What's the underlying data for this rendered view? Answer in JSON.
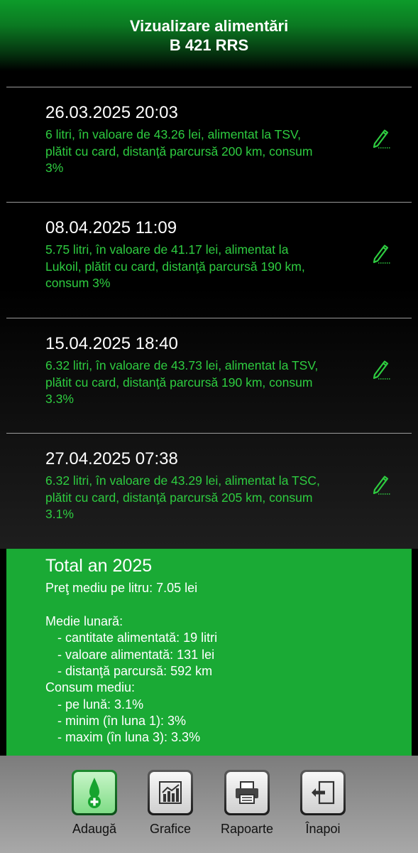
{
  "header": {
    "title": "Vizualizare alimentări",
    "subtitle": "B 421 RRS"
  },
  "entries": [
    {
      "date": "26.03.2025 20:03",
      "lines": [
        "6 litri, în valoare de 43.26 lei, alimentat la TSV,",
        "plătit cu card, distanţă parcursă 200 km, consum",
        "3%"
      ]
    },
    {
      "date": "08.04.2025 11:09",
      "lines": [
        "5.75 litri, în valoare de 41.17 lei, alimentat la",
        "Lukoil, plătit cu card, distanţă parcursă 190 km,",
        "consum 3%"
      ]
    },
    {
      "date": "15.04.2025 18:40",
      "lines": [
        "6.32 litri, în valoare de 43.73 lei, alimentat la TSV,",
        "plătit cu card, distanţă parcursă 190 km, consum",
        "3.3%"
      ]
    },
    {
      "date": "27.04.2025 07:38",
      "lines": [
        "6.32 litri, în valoare de 43.29 lei, alimentat la TSC,",
        "plătit cu card, distanţă parcursă 205 km, consum",
        "3.1%"
      ]
    }
  ],
  "summary": {
    "title": "Total an 2025",
    "price_line": "Preţ mediu pe litru: 7.05 lei",
    "monthly_heading": "Medie lunară:",
    "monthly": [
      "- cantitate alimentată: 19 litri",
      "- valoare alimentată: 131 lei",
      "- distanţă parcursă: 592 km"
    ],
    "consumption_heading": "Consum mediu:",
    "consumption": [
      "- pe lună: 3.1%",
      "- minim (în luna 1): 3%",
      "- maxim (în luna 3): 3.3%"
    ]
  },
  "toolbar": {
    "add": "Adaugă",
    "charts": "Grafice",
    "reports": "Rapoarte",
    "back": "Înapoi"
  },
  "icons": {
    "edit": "pencil-icon",
    "add": "fuel-drop-plus-icon",
    "charts": "bar-chart-icon",
    "reports": "printer-icon",
    "back": "exit-arrow-icon"
  },
  "colors": {
    "accent_green": "#1aaa35",
    "entry_text": "#2ecc40"
  }
}
